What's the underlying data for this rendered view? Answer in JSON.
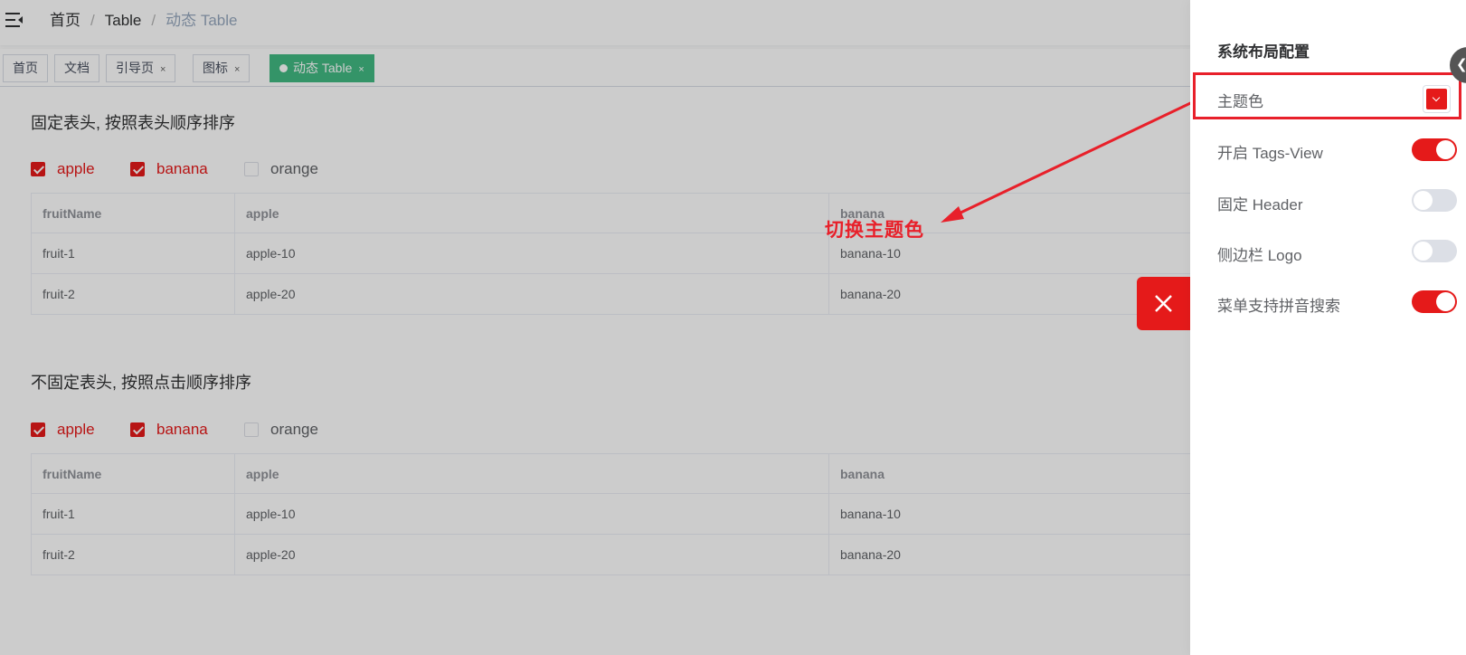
{
  "breadcrumb": {
    "home": "首页",
    "table": "Table",
    "current": "动态 Table",
    "separator": "/"
  },
  "tags": [
    {
      "label": "首页",
      "closable": false
    },
    {
      "label": "文档",
      "closable": false
    },
    {
      "label": "引导页",
      "closable": true
    },
    {
      "label": "图标",
      "closable": true
    },
    {
      "label": "动态 Table",
      "closable": true,
      "active": true
    }
  ],
  "close_glyph": "×",
  "sections": [
    {
      "title": "固定表头, 按照表头顺序排序",
      "checks": [
        {
          "label": "apple",
          "checked": true
        },
        {
          "label": "banana",
          "checked": true
        },
        {
          "label": "orange",
          "checked": false
        }
      ],
      "headers": [
        "fruitName",
        "apple",
        "banana"
      ],
      "rows": [
        [
          "fruit-1",
          "apple-10",
          "banana-10"
        ],
        [
          "fruit-2",
          "apple-20",
          "banana-20"
        ]
      ]
    },
    {
      "title": "不固定表头, 按照点击顺序排序",
      "checks": [
        {
          "label": "apple",
          "checked": true
        },
        {
          "label": "banana",
          "checked": true
        },
        {
          "label": "orange",
          "checked": false
        }
      ],
      "headers": [
        "fruitName",
        "apple",
        "banana"
      ],
      "rows": [
        [
          "fruit-1",
          "apple-10",
          "banana-10"
        ],
        [
          "fruit-2",
          "apple-20",
          "banana-20"
        ]
      ]
    }
  ],
  "annotation": "切换主题色",
  "settings": {
    "title": "系统布局配置",
    "theme_label": "主题色",
    "theme_color": "#e51a1a",
    "items": [
      {
        "label": "开启 Tags-View",
        "on": true
      },
      {
        "label": "固定 Header",
        "on": false
      },
      {
        "label": "侧边栏 Logo",
        "on": false
      },
      {
        "label": "菜单支持拼音搜索",
        "on": true
      }
    ]
  },
  "colors": {
    "accent": "#e51a1a",
    "tag_active": "#42b983",
    "annotation": "#e8202a"
  },
  "icons": {
    "menu": "hamburger-icon",
    "close": "close-icon",
    "dropdown": "chevron-down-icon",
    "handle": "chevron-left-icon"
  }
}
